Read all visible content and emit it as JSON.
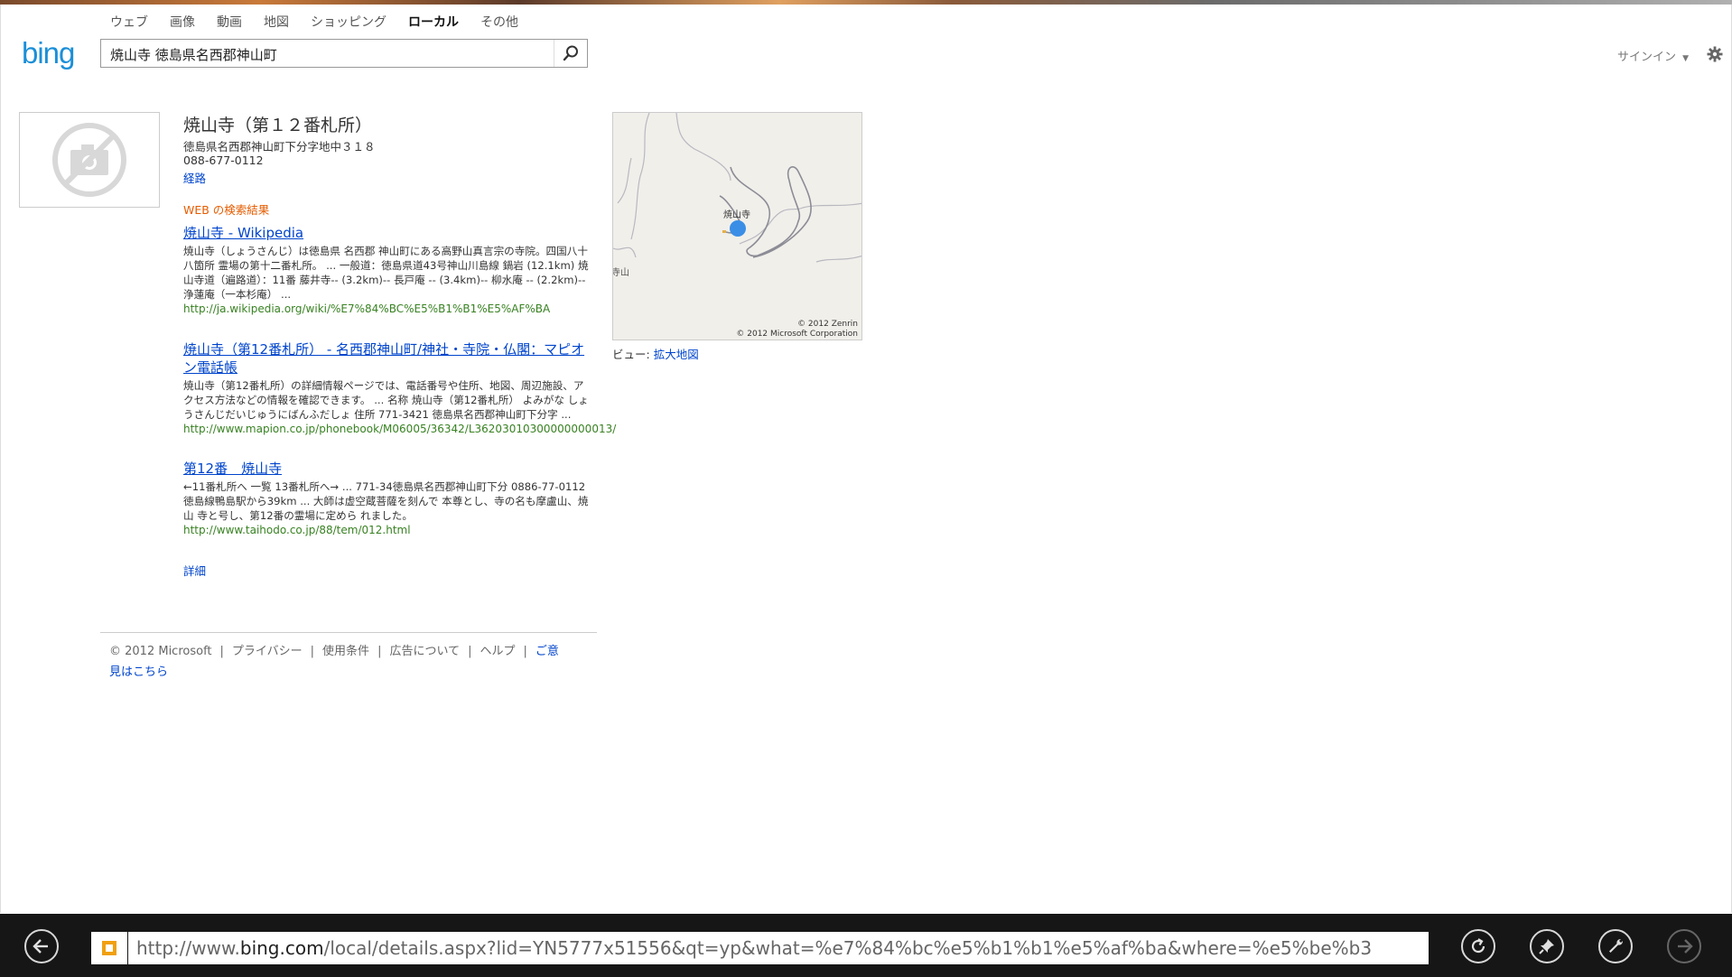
{
  "nav": {
    "tabs": [
      "ウェブ",
      "画像",
      "動画",
      "地図",
      "ショッピング",
      "ローカル",
      "その他"
    ],
    "active": "ローカル"
  },
  "brand": {
    "logo_text": "bing",
    "color": "#1b8fd8"
  },
  "search": {
    "value": "焼山寺 徳島県名西郡神山町"
  },
  "header": {
    "signin_label": "サインイン"
  },
  "listing": {
    "title": "焼山寺（第１２番札所）",
    "address": "徳島県名西郡神山町下分字地中３１８",
    "phone": "088-677-0112",
    "directions_label": "経路"
  },
  "web": {
    "heading": "WEB の検索結果",
    "results": [
      {
        "title": "焼山寺 - Wikipedia",
        "snippet": "焼山寺（しょうさんじ）は徳島県 名西郡 神山町にある高野山真言宗の寺院。四国八十八箇所 霊場の第十二番札所。 ... 一般道：徳島県道43号神山川島線 鍋岩 (12.1km) 焼山寺道（遍路道）：11番 藤井寺-- (3.2km)-- 長戸庵 -- (3.4km)-- 柳水庵 -- (2.2km)-- 浄蓮庵（一本杉庵） ...",
        "url": "http://ja.wikipedia.org/wiki/%E7%84%BC%E5%B1%B1%E5%AF%BA"
      },
      {
        "title": "焼山寺（第12番札所） - 名西郡神山町/神社・寺院・仏閣：マピオン電話帳",
        "snippet": "焼山寺（第12番札所）の詳細情報ページでは、電話番号や住所、地図、周辺施設、アクセス方法などの情報を確認できます。 ... 名称 焼山寺（第12番札所） よみがな しょうさんじだいじゅうにばんふだしょ 住所 771-3421 徳島県名西郡神山町下分字 ...",
        "url": "http://www.mapion.co.jp/phonebook/M06005/36342/L36203010300000000013/"
      },
      {
        "title": "第12番　焼山寺",
        "snippet": "←11番札所へ 一覧 13番札所へ→ ... 771-34徳島県名西郡神山町下分 0886-77-0112 徳島線鴨島駅から39km ... 大師は虚空蔵菩薩を刻んで 本尊とし、寺の名も摩盧山、焼山 寺と号し、第12番の霊場に定めら れました。",
        "url": "http://www.taihodo.co.jp/88/tem/012.html"
      }
    ],
    "more_label": "詳細"
  },
  "map": {
    "pin_label": "焼山寺",
    "edge_label": "寺山",
    "credit_zenrin": "© 2012 Zenrin",
    "credit_microsoft": "© 2012 Microsoft Corporation",
    "view_label": "ビュー:",
    "expand_label": "拡大地図",
    "pin_color": "#3a8ee6"
  },
  "footer": {
    "copyright": "© 2012 Microsoft",
    "links": [
      "プライバシー",
      "使用条件",
      "広告について",
      "ヘルプ"
    ],
    "feedback_label_1": "ご意",
    "feedback_label_2": "見はこちら"
  },
  "appbar": {
    "url_prefix": "http://www.",
    "url_domain": "bing.com",
    "url_rest": "/local/details.aspx?lid=YN5777x51556&qt=yp&what=%e7%84%bc%e5%b1%b1%e5%af%ba&where=%e5%be%b3",
    "buttons": [
      "back-icon",
      "refresh-icon",
      "pin-icon",
      "tools-icon",
      "forward-icon"
    ]
  }
}
